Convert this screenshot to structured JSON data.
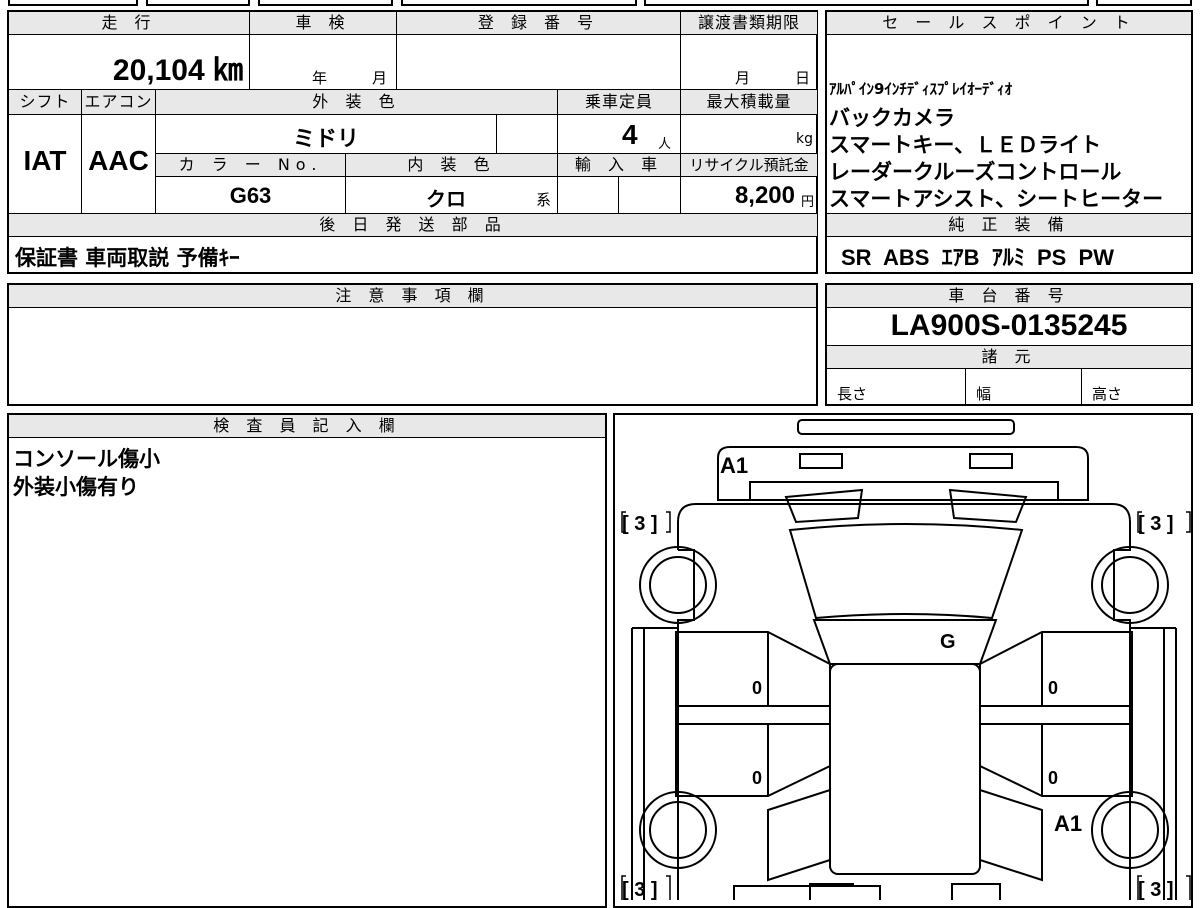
{
  "spec": {
    "mileage_label": "走 行",
    "mileage_value": "20,104 ㎞",
    "shaken_label": "車 検",
    "shaken_year_unit": "年",
    "shaken_month_unit": "月",
    "reg_label": "登 録 番 号",
    "reg_value": "",
    "transfer_label": "譲渡書類期限",
    "transfer_month_unit": "月",
    "transfer_day_unit": "日",
    "shift_label": "シフト",
    "shift_value": "IAT",
    "ac_label": "エアコン",
    "ac_value": "AAC",
    "ext_color_label": "外 装 色",
    "ext_color_value": "ミドリ",
    "capacity_label": "乗車定員",
    "capacity_value": "4",
    "capacity_unit": "人",
    "maxload_label": "最大積載量",
    "maxload_unit": "kg",
    "colorno_label": "カ ラ ー No.",
    "colorno_value": "G63",
    "int_color_label": "内 装 色",
    "int_color_value": "クロ",
    "int_color_unit": "系",
    "import_label": "輸 入 車",
    "recycle_label": "リサイクル預託金",
    "recycle_value": "8,200",
    "recycle_unit": "円",
    "later_parts_label": "後 日 発 送 部 品",
    "later_parts_value": "保証書 車両取説 予備ｷｰ"
  },
  "sales": {
    "label": "セ ー ル ス ポ イ ン ト",
    "lines": [
      "ｱﾙﾊﾟｲﾝ9ｲﾝﾁﾃﾞｨｽﾌﾟﾚｲｵｰﾃﾞｨｵ",
      "バックカメラ",
      "スマートキー、ＬＥＤライト",
      "レーダークルーズコントロール",
      "スマートアシスト、シートヒーター"
    ]
  },
  "equipment": {
    "label": "純 正 装 備",
    "value": "SR  ABS  ｴｱB  ｱﾙﾐ  PS  PW"
  },
  "notes": {
    "label": "注 意 事 項 欄",
    "value": ""
  },
  "chassis": {
    "label": "車 台 番 号",
    "value": "LA900S-0135245",
    "specs_label": "諸 元",
    "length_label": "長さ",
    "width_label": "幅",
    "height_label": "高さ"
  },
  "inspector": {
    "label": "検 査 員 記 入 欄",
    "lines": [
      "コンソール傷小",
      "外装小傷有り"
    ]
  },
  "diagram": {
    "marks": {
      "front_bumper": "A1",
      "rear_bumper": "A1",
      "windshield": "G",
      "door_fl": "0",
      "door_rl": "0",
      "door_fr": "0",
      "door_rr": "0",
      "tire_fl": "[ 3 ]",
      "tire_fr": "[ 3 ]",
      "tire_rl": "[ 3 ]",
      "tire_rr": "[ 3 ]"
    }
  }
}
